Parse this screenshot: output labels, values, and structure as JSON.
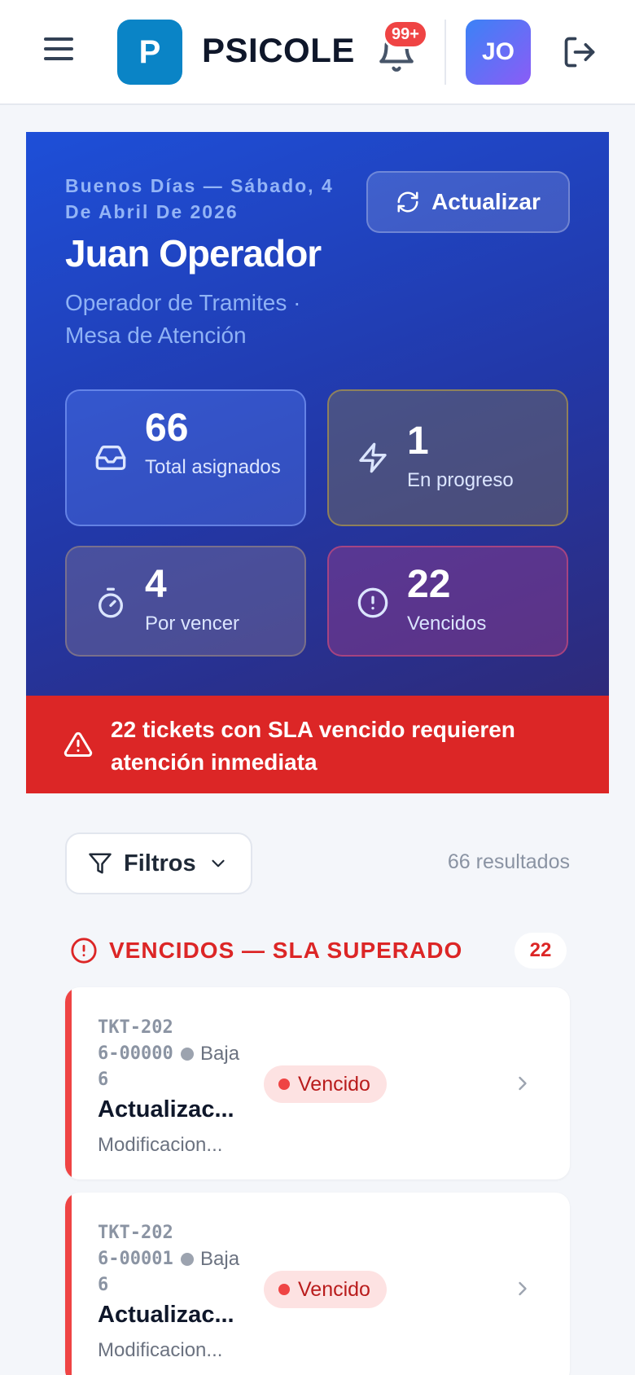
{
  "header": {
    "logo_letter": "P",
    "brand": "PSICOLE",
    "notifications_badge": "99+",
    "avatar_initials": "JO"
  },
  "hero": {
    "greeting": "Buenos Días — Sábado, 4 De Abril De 2026",
    "user_name": "Juan Operador",
    "role": "Operador de Tramites · Mesa de Atención",
    "refresh_label": "Actualizar",
    "stats": {
      "total": {
        "value": "66",
        "label": "Total asignados"
      },
      "in_progress": {
        "value": "1",
        "label": "En progreso"
      },
      "due_soon": {
        "value": "4",
        "label": "Por vencer"
      },
      "overdue": {
        "value": "22",
        "label": "Vencidos"
      }
    }
  },
  "alert": {
    "text": "22 tickets con SLA vencido requieren atención inmediata"
  },
  "filters": {
    "label": "Filtros",
    "results": "66 resultados"
  },
  "section": {
    "title": "VENCIDOS — SLA SUPERADO",
    "count": "22"
  },
  "tickets": [
    {
      "id": "TKT-2026-000006",
      "priority": "Baja",
      "title": "Actualizac...",
      "subtitle": "Modificacion...",
      "status": "Vencido"
    },
    {
      "id": "TKT-2026-000016",
      "priority": "Baja",
      "title": "Actualizac...",
      "subtitle": "Modificacion...",
      "status": "Vencido"
    }
  ],
  "colors": {
    "brand_blue": "#0a84c6",
    "hero_gradient_start": "#1e4fd8",
    "hero_gradient_end": "#2e2a7a",
    "alert_red": "#dc2626",
    "badge_red": "#ef4444"
  },
  "icons": [
    "hamburger-menu-icon",
    "bell-icon",
    "logout-icon",
    "refresh-icon",
    "inbox-icon",
    "lightning-icon",
    "timer-icon",
    "alert-circle-icon",
    "warning-triangle-icon",
    "filter-icon",
    "chevron-down-icon",
    "chevron-right-icon"
  ]
}
